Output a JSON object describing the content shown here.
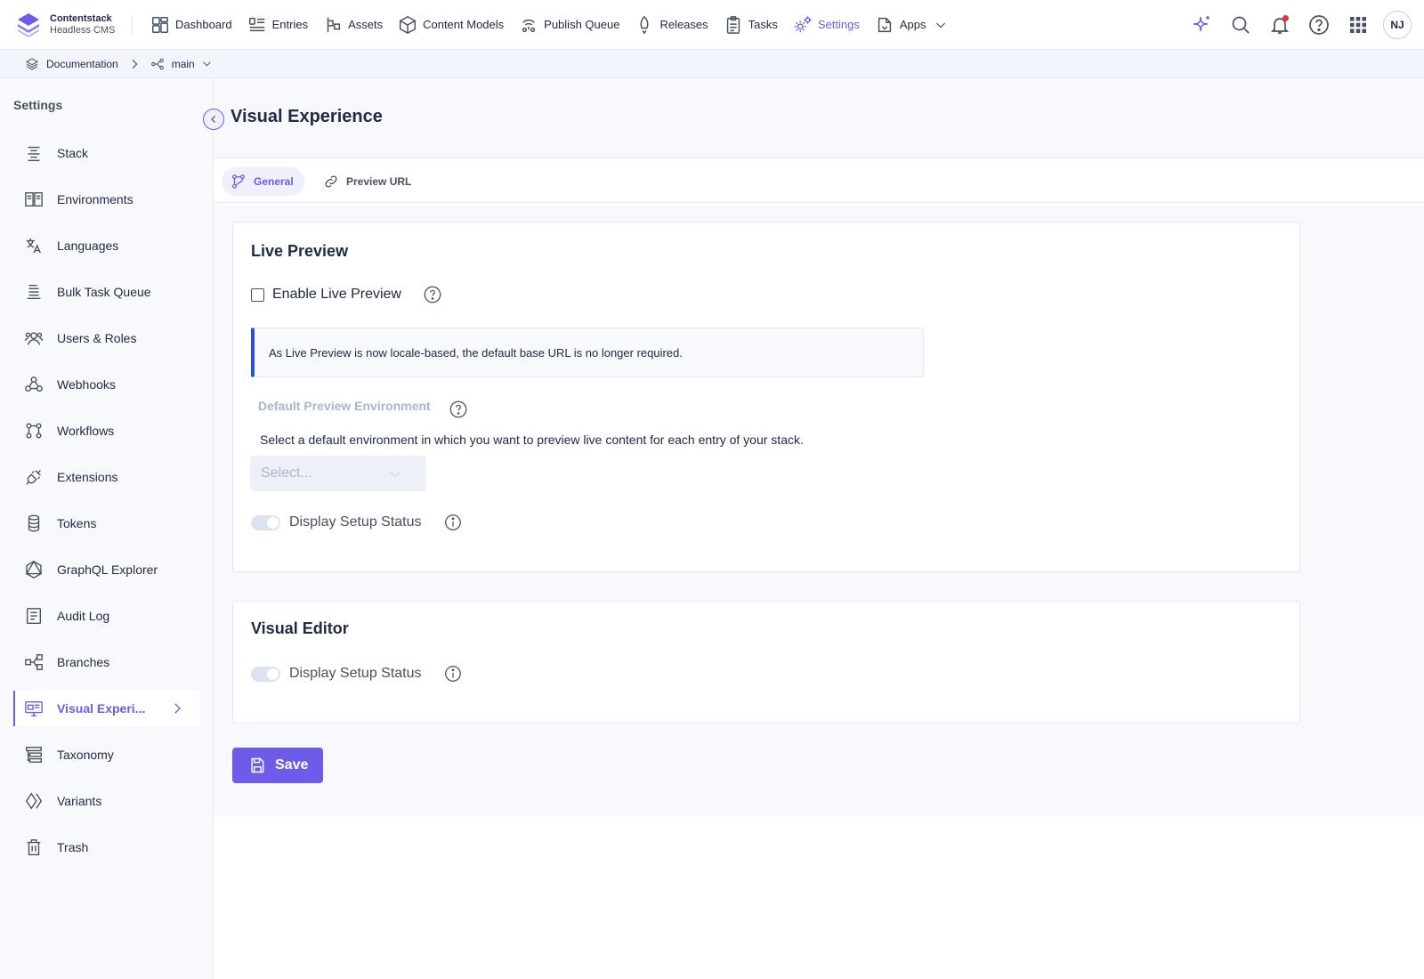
{
  "brand": {
    "name": "Contentstack",
    "sub": "Headless CMS"
  },
  "nav": {
    "items": [
      {
        "label": "Dashboard",
        "icon": "dashboard-icon"
      },
      {
        "label": "Entries",
        "icon": "entries-icon"
      },
      {
        "label": "Assets",
        "icon": "assets-icon"
      },
      {
        "label": "Content Models",
        "icon": "content-models-icon"
      },
      {
        "label": "Publish Queue",
        "icon": "publish-queue-icon"
      },
      {
        "label": "Releases",
        "icon": "releases-icon"
      },
      {
        "label": "Tasks",
        "icon": "tasks-icon"
      },
      {
        "label": "Settings",
        "icon": "settings-icon",
        "active": true
      },
      {
        "label": "Apps",
        "icon": "apps-icon"
      }
    ],
    "avatar": "NJ",
    "accent": "#6c5ce7",
    "notification_dot_color": "#e3343e"
  },
  "breadcrumb": {
    "stack": "Documentation",
    "branch": "main"
  },
  "sidebar": {
    "title": "Settings",
    "items": [
      {
        "label": "Stack"
      },
      {
        "label": "Environments"
      },
      {
        "label": "Languages"
      },
      {
        "label": "Bulk Task Queue"
      },
      {
        "label": "Users & Roles"
      },
      {
        "label": "Webhooks"
      },
      {
        "label": "Workflows"
      },
      {
        "label": "Extensions"
      },
      {
        "label": "Tokens"
      },
      {
        "label": "GraphQL Explorer"
      },
      {
        "label": "Audit Log"
      },
      {
        "label": "Branches"
      },
      {
        "label": "Visual Experi...",
        "active": true
      },
      {
        "label": "Taxonomy"
      },
      {
        "label": "Variants"
      },
      {
        "label": "Trash"
      }
    ]
  },
  "main": {
    "title": "Visual Experience",
    "tabs": [
      {
        "label": "General",
        "active": true
      },
      {
        "label": "Preview URL"
      }
    ],
    "live_preview": {
      "title": "Live Preview",
      "enable_label": "Enable Live Preview",
      "enabled": false,
      "notice": "As Live Preview is now locale-based, the default base URL is no longer required.",
      "notice_accent": "#2b4fd8",
      "env_label": "Default Preview Environment",
      "env_description": "Select a default environment in which you want to preview live content for each entry of your stack.",
      "env_placeholder": "Select...",
      "setup_status_label": "Display Setup Status"
    },
    "visual_editor": {
      "title": "Visual Editor",
      "setup_status_label": "Display Setup Status"
    },
    "save_label": "Save"
  }
}
